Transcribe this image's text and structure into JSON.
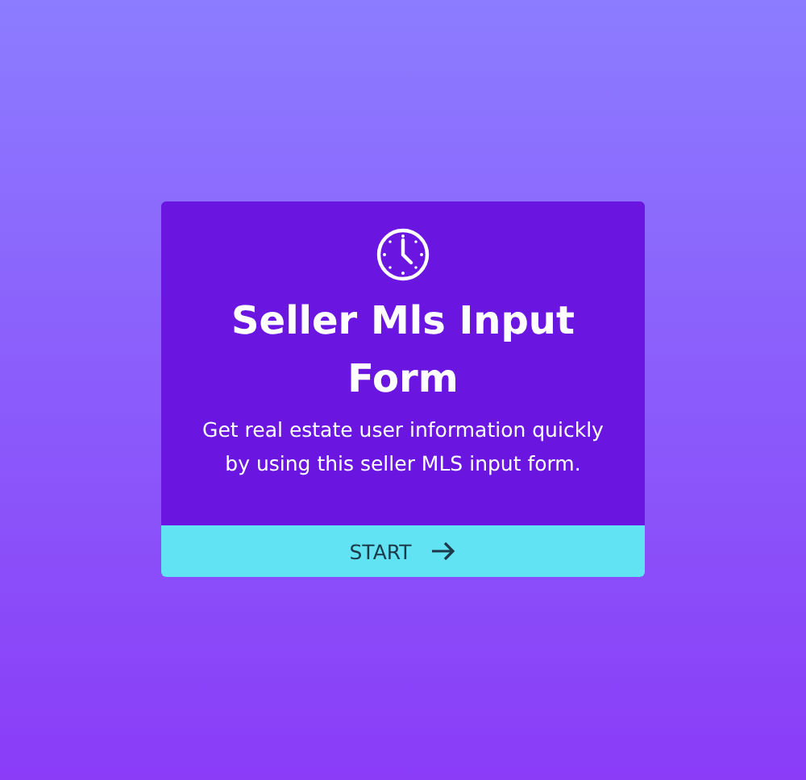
{
  "card": {
    "title": "Seller Mls Input Form",
    "description": "Get real estate user information quickly by using this seller MLS input form.",
    "start_button": {
      "label": "START"
    }
  }
}
